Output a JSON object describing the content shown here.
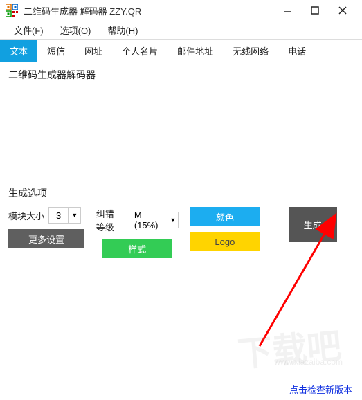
{
  "window": {
    "title": "二维码生成器 解码器 ZZY.QR"
  },
  "menu": {
    "file": "文件(F)",
    "options": "选项(O)",
    "help": "帮助(H)"
  },
  "tabs": {
    "text": "文本",
    "sms": "短信",
    "url": "网址",
    "card": "个人名片",
    "email": "邮件地址",
    "wifi": "无线网络",
    "phone": "电话"
  },
  "content": {
    "text": "二维码生成器解码器"
  },
  "options": {
    "title": "生成选项",
    "module_size_label": "模块大小",
    "module_size_value": "3",
    "ecc_label": "纠错等级",
    "ecc_value": "M (15%)",
    "color_btn": "颜色",
    "style_btn": "样式",
    "logo_btn": "Logo",
    "more_btn": "更多设置",
    "generate_btn": "生成"
  },
  "status": {
    "link_text": "点击检查新版本"
  }
}
